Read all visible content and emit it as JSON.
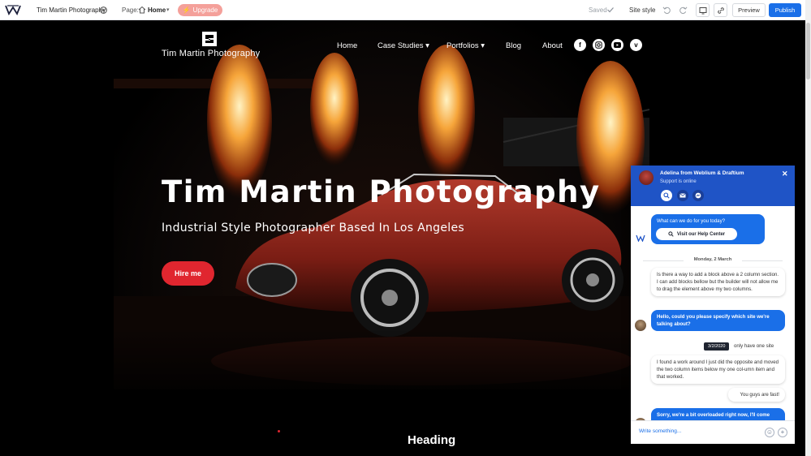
{
  "editor": {
    "site_name": "Tim Martin Photography",
    "page_label": "Page:",
    "page_value": "Home",
    "upgrade_label": "Upgrade",
    "saved_label": "Saved",
    "site_style_label": "Site style",
    "preview_label": "Preview",
    "publish_label": "Publish"
  },
  "site": {
    "brand": "Tim Martin Photography",
    "nav": [
      "Home",
      "Case Studies ▾",
      "Portfolios ▾",
      "Blog",
      "About"
    ],
    "social": [
      "facebook",
      "instagram",
      "youtube",
      "vimeo"
    ],
    "hero_title": "Tim Martin Photography",
    "hero_subtitle": "Industrial Style Photographer Based In Los Angeles",
    "hire_label": "Hire me",
    "section_heading": "Heading"
  },
  "chat": {
    "agent_name": "Adelina from Weblium & Draftium",
    "agent_status": "Support is online",
    "welcome": "What can we do for you today?",
    "help_center_label": "Visit our Help Center",
    "date_divider": "Monday, 2 March",
    "messages": [
      "Is there a way to add a block above a 2 column section. I can add blocks bellow but the builder will not allow me to drag the element above my two columns.",
      "Hello, could you please specify which site we're talking about?",
      "only have one site",
      "I found a work around I just did the opposite and moved the two column items below my one col-umn item and that worked.",
      "You guys are fast!",
      "Sorry, we're a bit overloaded right now, I'll come"
    ],
    "tooltip": "3/2/2020",
    "input_placeholder": "Write something...",
    "accent_color": "#1a6fe8"
  },
  "colors": {
    "primary": "#1a6fe8",
    "hire": "#e0262f",
    "upgrade": "#f4a09a"
  }
}
